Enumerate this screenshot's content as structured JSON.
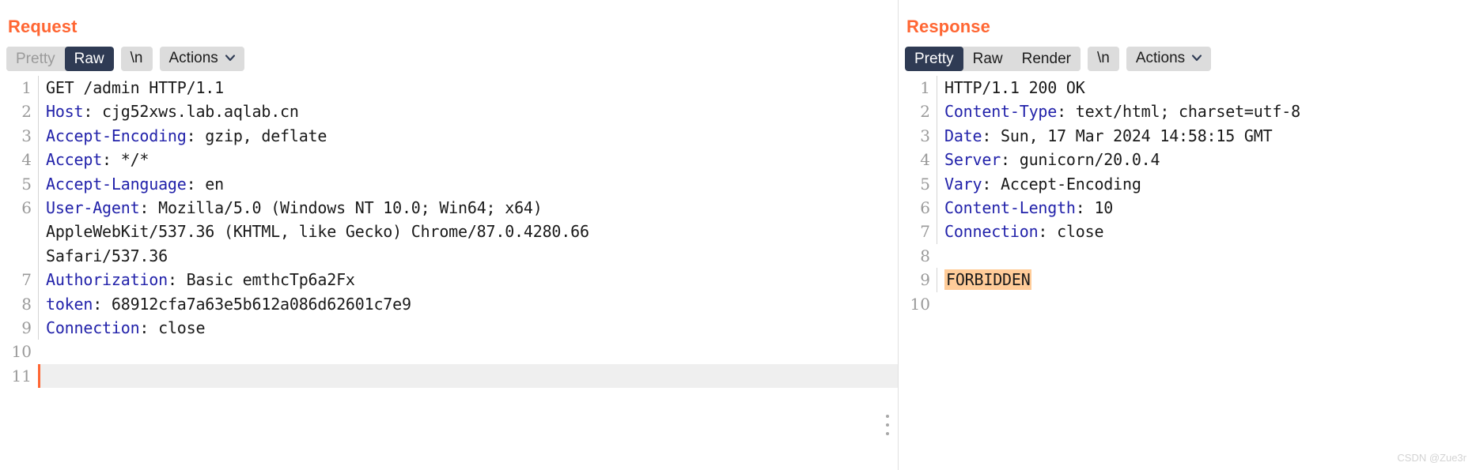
{
  "request": {
    "title": "Request",
    "toolbar": {
      "group": [
        {
          "label": "Pretty",
          "state": "inactive"
        },
        {
          "label": "Raw",
          "state": "active"
        }
      ],
      "newline_label": "\\n",
      "actions_label": "Actions"
    },
    "lines": [
      {
        "num": "1",
        "header": "",
        "value": "GET /admin HTTP/1.1"
      },
      {
        "num": "2",
        "header": "Host",
        "value": ": cjg52xws.lab.aqlab.cn"
      },
      {
        "num": "3",
        "header": "Accept-Encoding",
        "value": ": gzip, deflate"
      },
      {
        "num": "4",
        "header": "Accept",
        "value": ": */*"
      },
      {
        "num": "5",
        "header": "Accept-Language",
        "value": ": en"
      },
      {
        "num": "6",
        "header": "User-Agent",
        "value": ": Mozilla/5.0 (Windows NT 10.0; Win64; x64)"
      },
      {
        "num": "",
        "header": "",
        "value": "AppleWebKit/537.36 (KHTML, like Gecko) Chrome/87.0.4280.66"
      },
      {
        "num": "",
        "header": "",
        "value": "Safari/537.36"
      },
      {
        "num": "7",
        "header": "Authorization",
        "value": ": Basic emthcTp6a2Fx"
      },
      {
        "num": "8",
        "header": "token",
        "value": ": 68912cfa7a63e5b612a086d62601c7e9"
      },
      {
        "num": "9",
        "header": "Connection",
        "value": ": close"
      },
      {
        "num": "10",
        "header": "",
        "value": ""
      },
      {
        "num": "11",
        "header": "",
        "value": ""
      }
    ]
  },
  "response": {
    "title": "Response",
    "toolbar": {
      "group": [
        {
          "label": "Pretty",
          "state": "active"
        },
        {
          "label": "Raw",
          "state": "normal"
        },
        {
          "label": "Render",
          "state": "normal"
        }
      ],
      "newline_label": "\\n",
      "actions_label": "Actions"
    },
    "lines": [
      {
        "num": "1",
        "header": "",
        "value": "HTTP/1.1 200 OK"
      },
      {
        "num": "2",
        "header": "Content-Type",
        "value": ": text/html; charset=utf-8"
      },
      {
        "num": "3",
        "header": "Date",
        "value": ": Sun, 17 Mar 2024 14:58:15 GMT"
      },
      {
        "num": "4",
        "header": "Server",
        "value": ": gunicorn/20.0.4"
      },
      {
        "num": "5",
        "header": "Vary",
        "value": ": Accept-Encoding"
      },
      {
        "num": "6",
        "header": "Content-Length",
        "value": ": 10"
      },
      {
        "num": "7",
        "header": "Connection",
        "value": ": close"
      },
      {
        "num": "8",
        "header": "",
        "value": ""
      },
      {
        "num": "9",
        "header": "",
        "value": "FORBIDDEN",
        "highlight": true
      },
      {
        "num": "10",
        "header": "",
        "value": ""
      }
    ]
  },
  "watermark": "CSDN @Zue3r",
  "colors": {
    "accent": "#ff6633",
    "header_blue": "#2222aa",
    "active_tab_bg": "#2f3b54",
    "tab_bg": "#dcdcdc",
    "mark_bg": "#ffcc99",
    "line_number": "#9a9a9a"
  }
}
